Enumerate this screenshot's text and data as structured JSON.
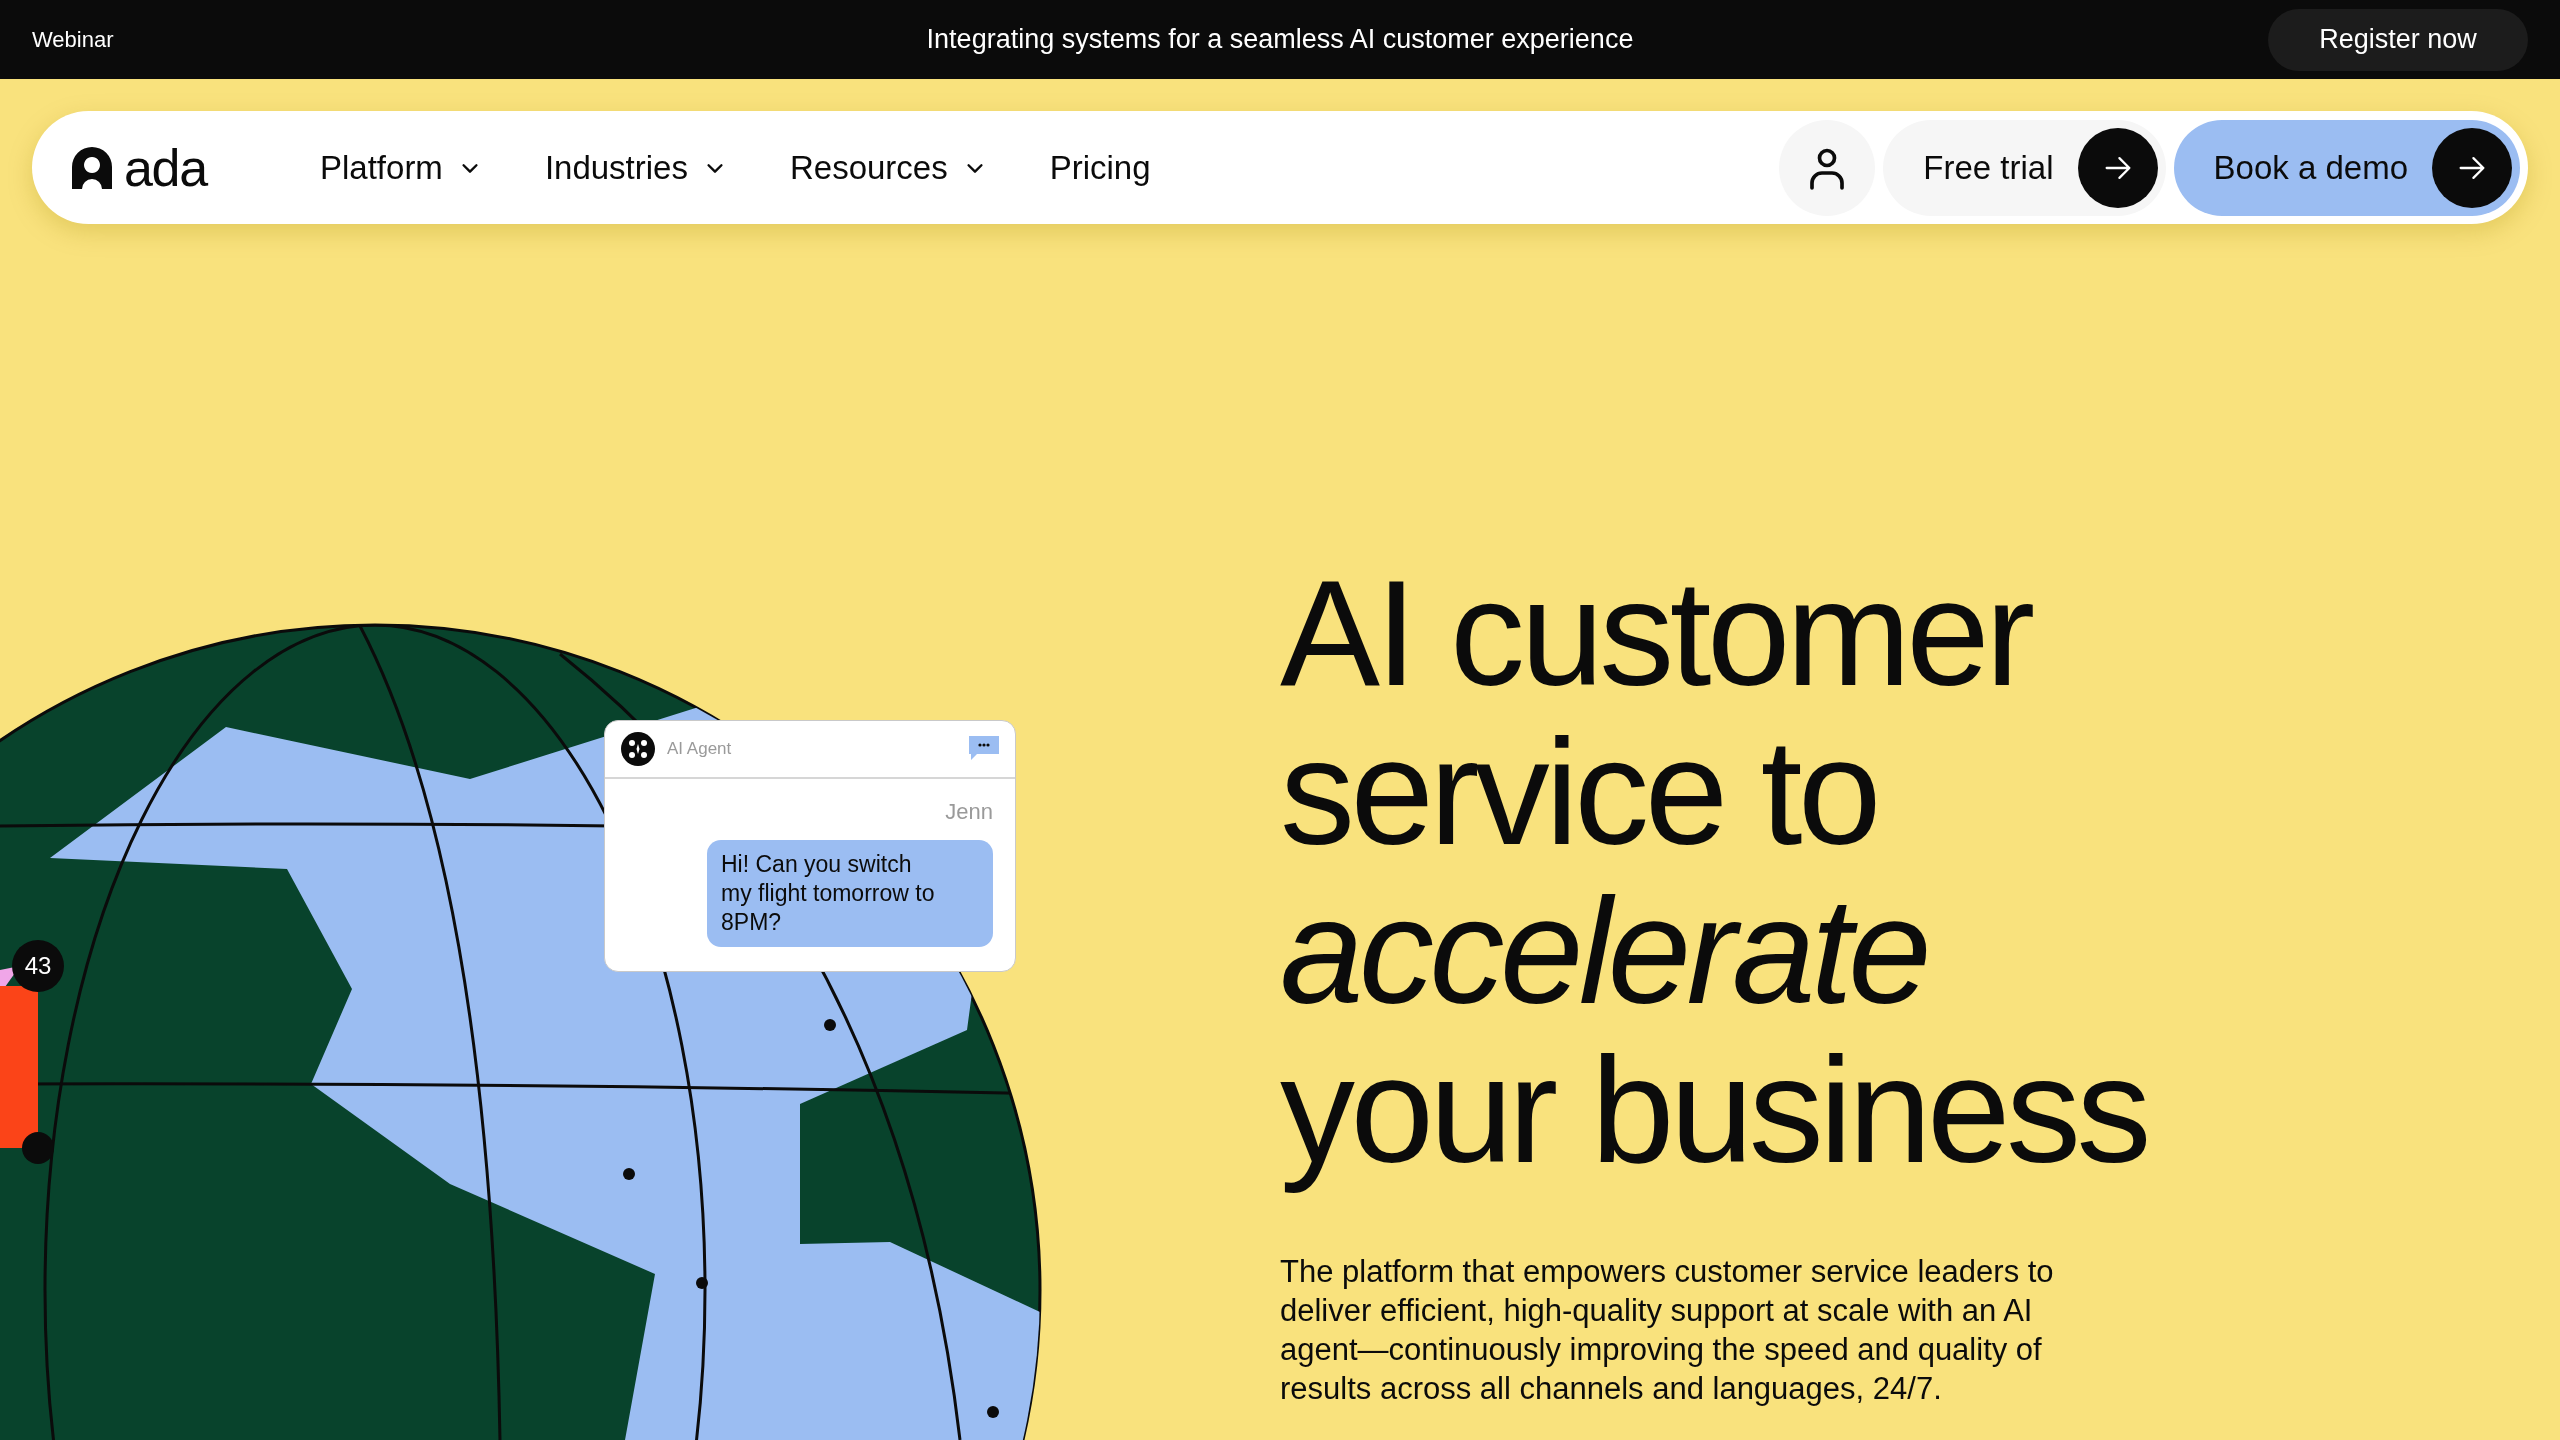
{
  "banner": {
    "tag": "Webinar",
    "message": "Integrating systems for a seamless AI customer experience",
    "button": "Register now"
  },
  "nav": {
    "logo": "ada",
    "items": [
      {
        "label": "Platform",
        "dropdown": true
      },
      {
        "label": "Industries",
        "dropdown": true
      },
      {
        "label": "Resources",
        "dropdown": true
      },
      {
        "label": "Pricing",
        "dropdown": false
      }
    ],
    "free_trial": "Free trial",
    "demo": "Book a demo"
  },
  "hero": {
    "headline": [
      {
        "text": "AI customer",
        "italic": false
      },
      {
        "text": "service to",
        "italic": false
      },
      {
        "text": "accelerate",
        "italic": true
      },
      {
        "text": "your business",
        "italic": false
      }
    ],
    "description": "The platform that empowers customer service leaders to deliver efficient, high-quality support at scale with an AI agent—continuously improving the speed and quality of results across all channels and languages, 24/7.",
    "badge": "43",
    "chat": {
      "agent": "AI Agent",
      "sender": "Jenn",
      "message": "Hi! Can you switch my flight tomorrow to 8PM?"
    }
  }
}
